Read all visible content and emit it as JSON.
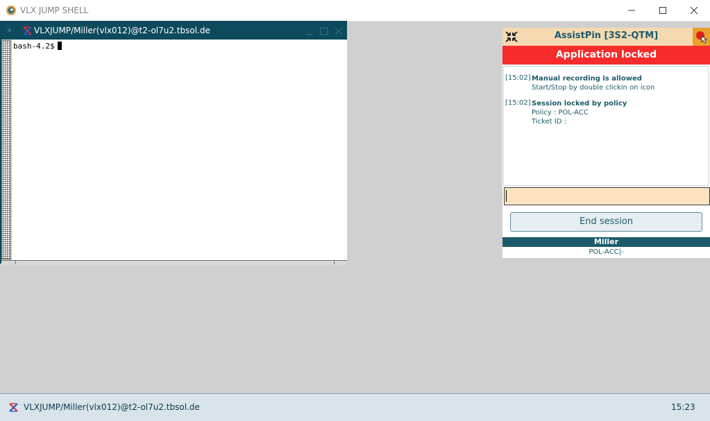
{
  "window": {
    "title": "VLX JUMP SHELL",
    "icon": "app-logo-icon"
  },
  "terminal": {
    "title": "VLXJUMP/Miller(vlx012)@t2-ol7u2.tbsol.de",
    "prompt": "bash-4.2$"
  },
  "assistpin": {
    "title": "AssistPin [3S2-QTM]",
    "status": "Application locked",
    "log": [
      {
        "time": "[15:02]",
        "headline": "Manual recording is allowed",
        "details": [
          "Start/Stop by double clickin on icon"
        ]
      },
      {
        "time": "[15:02]",
        "headline": "Session locked by policy",
        "details": [
          "Policy : POL-ACC",
          "Ticket ID :"
        ]
      }
    ],
    "input_value": "",
    "end_session_label": "End session",
    "user": "Miller",
    "policy_line": "POL-ACC|-",
    "colors": {
      "header_bg": "#f5d9b0",
      "locked_bg": "#f62b2b",
      "accent": "#1d5b6b"
    }
  },
  "taskbar": {
    "item_title": "VLXJUMP/Miller(vlx012)@t2-ol7u2.tbsol.de",
    "clock": "15:23"
  }
}
